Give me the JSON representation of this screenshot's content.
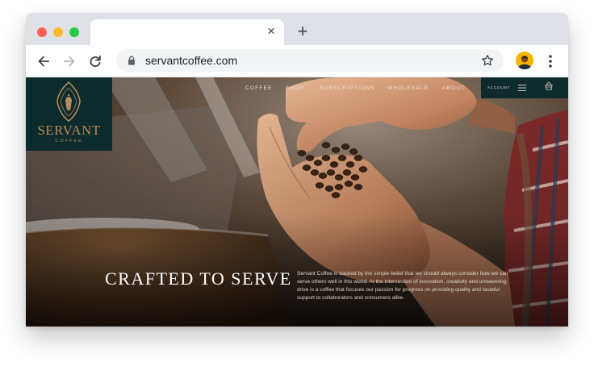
{
  "browser": {
    "url": "servantcoffee.com",
    "tab_close": "×",
    "new_tab": "+"
  },
  "site": {
    "nav": [
      "COFFEE",
      "SHOP",
      "SUBSCRIPTIONS",
      "WHOLESALE",
      "ABOUT"
    ],
    "account_label": "ACCOUNT",
    "logo": {
      "name": "SERVANT",
      "sub": "COFFEE"
    },
    "hero": {
      "headline": "CRAFTED TO SERVE",
      "body": "Servant Coffee is backed by the simple belief that we should always consider how we can serve others well in this world. At the intersection of innovation, creativity and unwavering drive is a coffee that focuses our passion for progress on providing quality and tasteful support to collaborators and consumers alike."
    }
  },
  "colors": {
    "brand_dark": "#0d2a2c",
    "brand_gold": "#b58a5c",
    "tab_strip": "#dee1e6"
  },
  "icons": [
    "back-arrow-icon",
    "forward-arrow-icon",
    "reload-icon",
    "lock-icon",
    "star-icon",
    "profile-avatar",
    "kebab-menu-icon",
    "hamburger-menu-icon",
    "cart-icon"
  ]
}
